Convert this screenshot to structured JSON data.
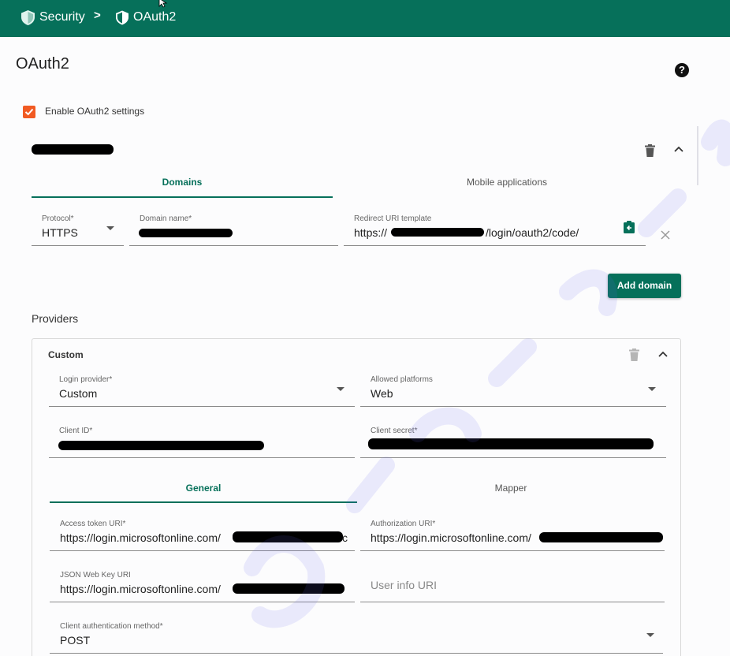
{
  "breadcrumb": {
    "items": [
      {
        "label": "Security",
        "icon": "shield-icon"
      },
      {
        "label": "OAuth2",
        "icon": "shield-icon"
      }
    ],
    "separator": ">"
  },
  "page": {
    "title": "OAuth2",
    "help_icon": "?"
  },
  "enable": {
    "label": "Enable OAuth2 settings",
    "checked": true
  },
  "domain_section": {
    "tabs": [
      {
        "label": "Domains",
        "active": true
      },
      {
        "label": "Mobile applications",
        "active": false
      }
    ],
    "fields": {
      "protocol": {
        "label": "Protocol*",
        "value": "HTTPS"
      },
      "domain_name": {
        "label": "Domain name*",
        "value": ""
      },
      "redirect_uri": {
        "label": "Redirect URI template",
        "prefix": "https://",
        "suffix": "/login/oauth2/code/"
      }
    },
    "add_domain_label": "Add domain"
  },
  "providers": {
    "title": "Providers",
    "card": {
      "title": "Custom",
      "login_provider": {
        "label": "Login provider*",
        "value": "Custom"
      },
      "allowed_platforms": {
        "label": "Allowed platforms",
        "value": "Web"
      },
      "client_id": {
        "label": "Client ID*"
      },
      "client_secret": {
        "label": "Client secret*"
      },
      "tabs": [
        {
          "label": "General",
          "active": true
        },
        {
          "label": "Mapper",
          "active": false
        }
      ],
      "access_token_uri": {
        "label": "Access token URI*",
        "value": "https://login.microsoftonline.com/",
        "tail": "c"
      },
      "authorization_uri": {
        "label": "Authorization URI*",
        "value": "https://login.microsoftonline.com/"
      },
      "jwk_uri": {
        "label": "JSON Web Key URI",
        "value": "https://login.microsoftonline.com/"
      },
      "user_info_uri": {
        "placeholder": "User info URI"
      },
      "client_auth_method": {
        "label": "Client authentication method*",
        "value": "POST"
      }
    }
  },
  "colors": {
    "primary": "#06705a",
    "checkbox": "#f15a22"
  }
}
